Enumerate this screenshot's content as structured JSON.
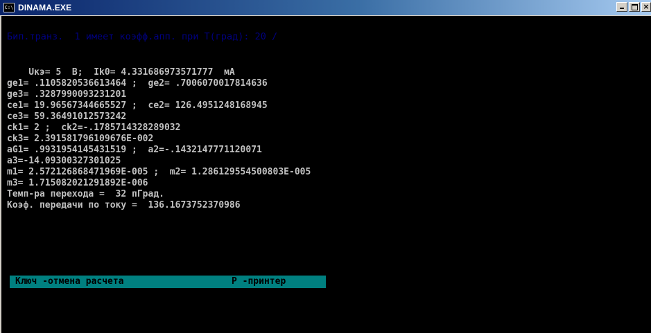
{
  "window": {
    "title": "DINAMA.EXE",
    "icon": "console-icon",
    "close_label": "×"
  },
  "console": {
    "header": "Бип.транз.  1 имеет коэфф.апп. при T(град): 20 /",
    "lines": [
      "    Uкэ= 5  B;  Ik0= 4.331686973571777  мА",
      "ge1= .1105820536613464 ;  ge2= .7006070017814636",
      "ge3= .3287990093231201",
      "ce1= 19.96567344665527 ;  ce2= 126.4951248168945",
      "ce3= 59.36491012573242",
      "ck1= 2 ;  ck2=-.1785714328289032",
      "ck3= 2.391581796109676E-002",
      "aG1= .9931954145431519 ;  a2=-.1432147771120071",
      "a3=-14.09300327301025",
      "m1= 2.572126868471969E-005 ;  m2= 1.286129554500803E-005",
      "m3= 1.715082021291892E-006",
      "Темп-ра перехода =  32 пГрад.",
      "Коэф. передачи по току =  136.1673752370986"
    ]
  },
  "status_bar": {
    "key_hint": "Ключ -отмена расчета",
    "printer_hint": "P -принтер"
  },
  "colors": {
    "console_bg": "#000000",
    "console_text": "#c0c0c0",
    "header_text": "#000080",
    "status_bg": "#008080",
    "titlebar": "#0a246a"
  }
}
